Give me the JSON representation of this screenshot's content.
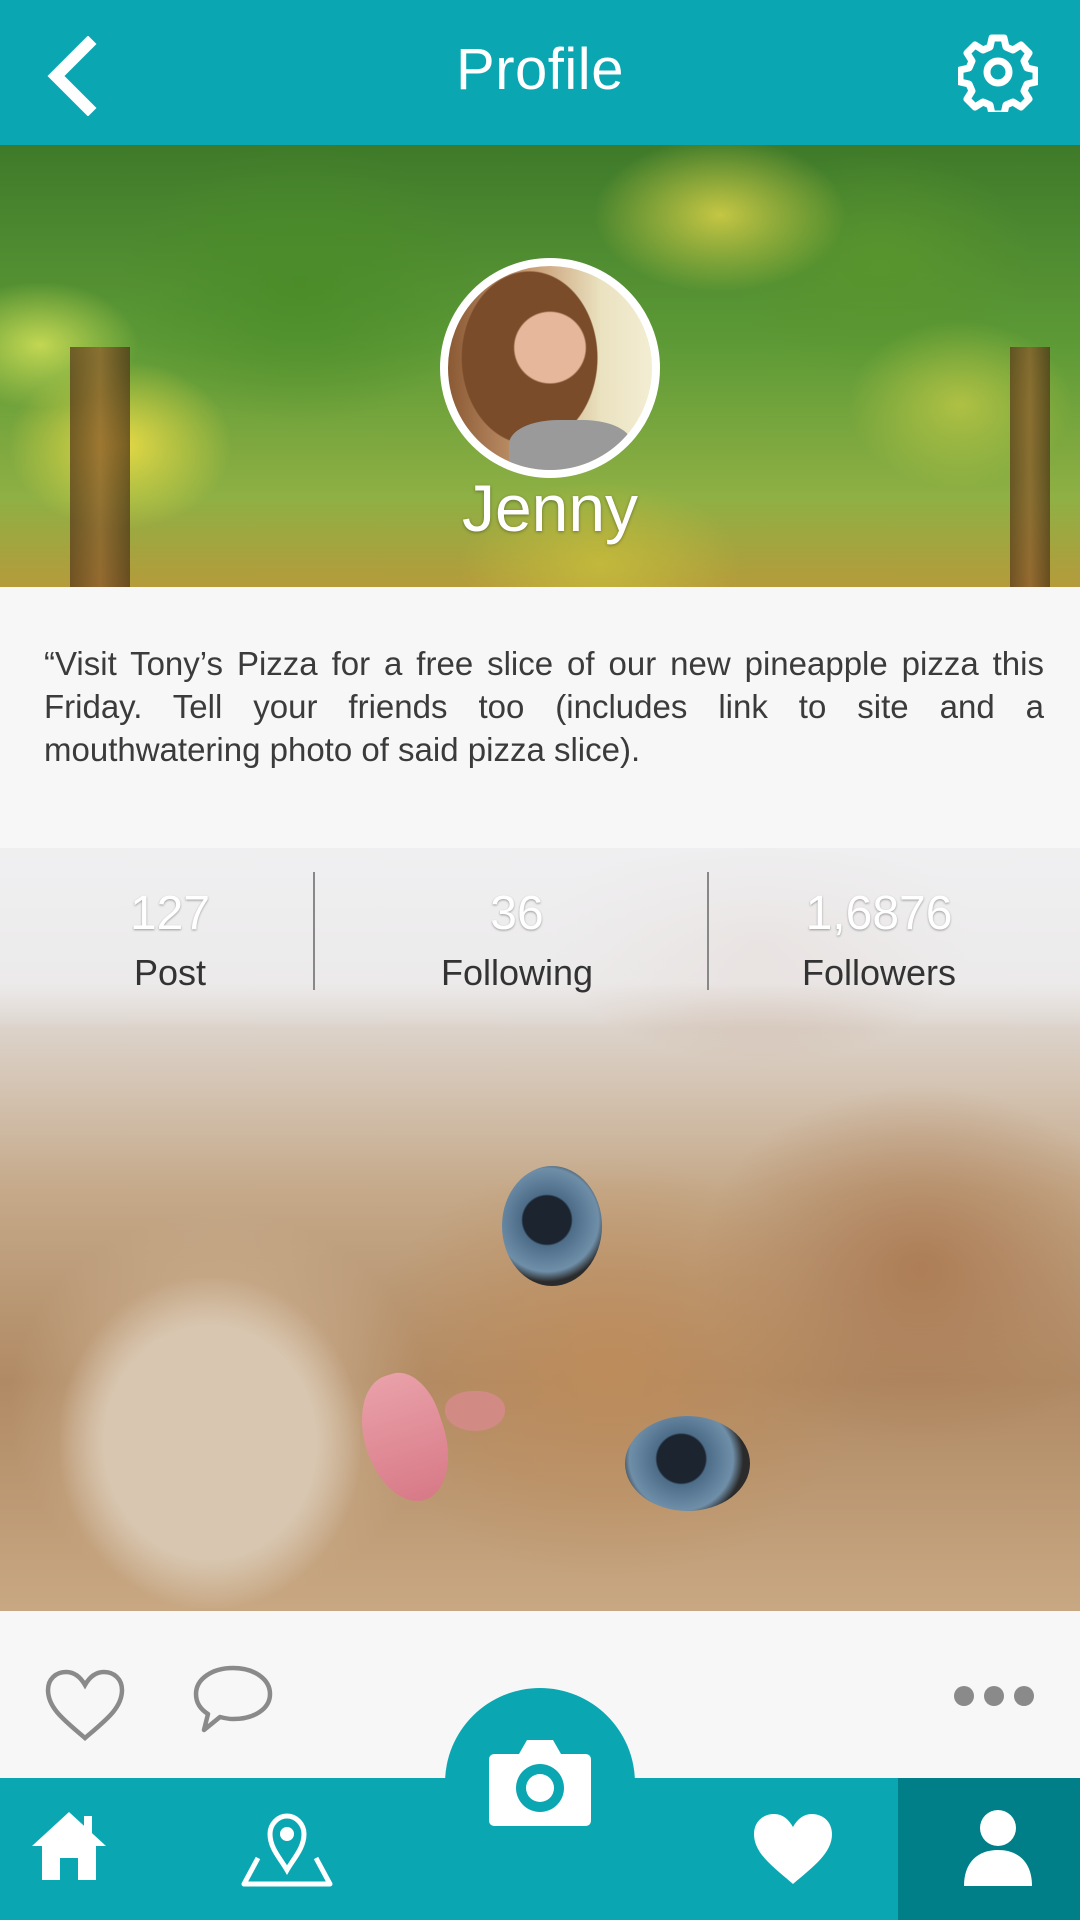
{
  "header": {
    "title": "Profile",
    "back_icon": "chevron-left-icon",
    "settings_icon": "gear-icon",
    "background_color": "#0aa7b3"
  },
  "profile": {
    "name": "Jenny",
    "quote": "“Visit Tony’s Pizza for a free slice of our new pineapple pizza this Friday. Tell your friends too (includes link to site and a mouthwatering photo of said pizza slice)."
  },
  "stats": [
    {
      "value": "127",
      "label": "Post"
    },
    {
      "value": "36",
      "label": "Following"
    },
    {
      "value": "1,6876",
      "label": "Followers"
    }
  ],
  "post_actions": {
    "like_icon": "heart-outline-icon",
    "comment_icon": "comment-icon",
    "more_icon": "more-dots-icon"
  },
  "tabbar": {
    "items": [
      "home-icon",
      "map-pin-icon",
      "camera-icon",
      "heart-icon",
      "person-icon"
    ],
    "active": "person-icon",
    "color": "#0aa7b3",
    "active_color": "#007f88"
  }
}
